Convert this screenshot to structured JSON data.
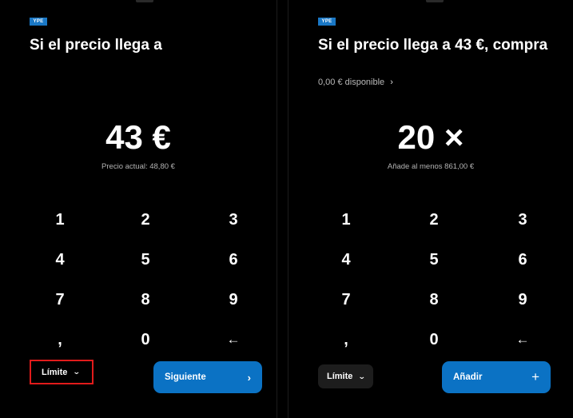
{
  "left": {
    "badge": "YPE",
    "heading": "Si el precio llega a",
    "big_value": "43 €",
    "sub_value": "Precio actual: 48,80 €",
    "keypad": [
      [
        "1",
        "2",
        "3"
      ],
      [
        "4",
        "5",
        "6"
      ],
      [
        "7",
        "8",
        "9"
      ],
      [
        ",",
        "0",
        "←"
      ]
    ],
    "limit_label": "Límite",
    "limit_chevron": "⌄",
    "primary_label": "Siguiente",
    "primary_icon": "›"
  },
  "right": {
    "badge": "YPE",
    "heading": "Si el precio llega a 43 €, compra",
    "available": "0,00 € disponible",
    "available_chevron": "›",
    "big_value": "20 ×",
    "sub_value": "Añade al menos 861,00 €",
    "keypad": [
      [
        "1",
        "2",
        "3"
      ],
      [
        "4",
        "5",
        "6"
      ],
      [
        "7",
        "8",
        "9"
      ],
      [
        ",",
        "0",
        "←"
      ]
    ],
    "limit_label": "Límite",
    "limit_chevron": "⌄",
    "primary_label": "Añadir",
    "primary_icon": "+"
  },
  "colors": {
    "background": "#000000",
    "badge": "#1a78c6",
    "primary_button": "#0b72c4",
    "highlight_border": "#e11b1b",
    "secondary_button": "#1d1d1d"
  }
}
